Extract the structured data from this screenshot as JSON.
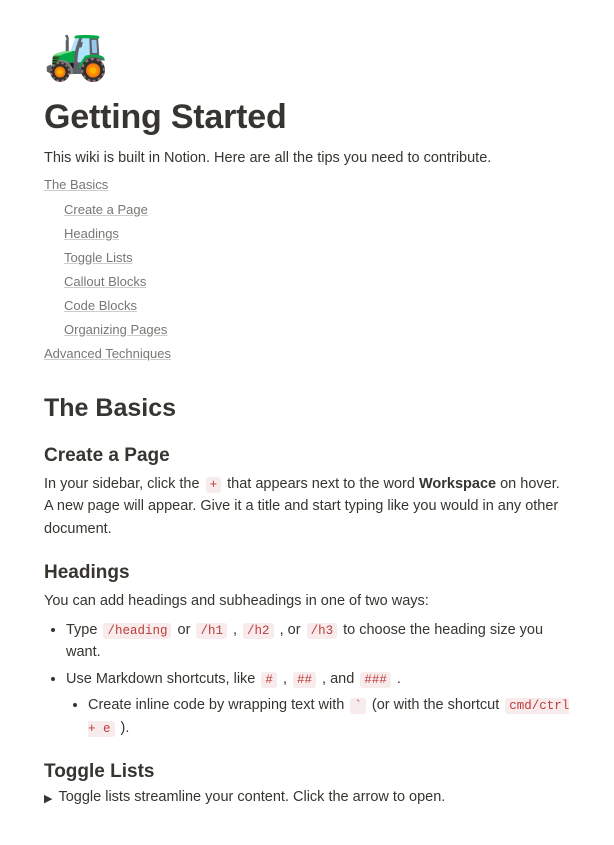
{
  "icon_emoji": "🚜",
  "title": "Getting Started",
  "intro": "This wiki is built in Notion. Here are all the tips you need to contribute.",
  "toc": {
    "basics": "The Basics",
    "create": "Create a Page",
    "headings": "Headings",
    "toggle": "Toggle Lists",
    "callout": "Callout Blocks",
    "code": "Code Blocks",
    "organizing": "Organizing Pages",
    "advanced": "Advanced Techniques"
  },
  "basics_heading": "The Basics",
  "create": {
    "heading": "Create a Page",
    "pre": "In your sidebar, click the ",
    "code": "+",
    "mid": " that appears next to the word ",
    "bold": "Workspace",
    "post": " on hover. A new page will appear. Give it a title and start typing like you would in any other document."
  },
  "headings": {
    "heading": "Headings",
    "intro": "You can add headings and subheadings in one of two ways:",
    "b1_pre": "Type ",
    "b1_c1": "/heading",
    "b1_or1": " or ",
    "b1_c2": "/h1",
    "b1_com1": " , ",
    "b1_c3": "/h2",
    "b1_com2": " , or ",
    "b1_c4": "/h3",
    "b1_post": " to choose the heading size you want.",
    "b2_pre": "Use Markdown shortcuts, like ",
    "b2_c1": "#",
    "b2_com1": " , ",
    "b2_c2": "##",
    "b2_com2": " , and ",
    "b2_c3": "###",
    "b2_post": " .",
    "b3_pre": "Create inline code by wrapping text with ",
    "b3_c1": "`",
    "b3_mid": " (or with the shortcut ",
    "b3_c2": "cmd/ctrl + e",
    "b3_post": " )."
  },
  "toggle": {
    "heading": "Toggle Lists",
    "arrow": "▶",
    "text": "Toggle lists streamline your content. Click the arrow to open."
  }
}
